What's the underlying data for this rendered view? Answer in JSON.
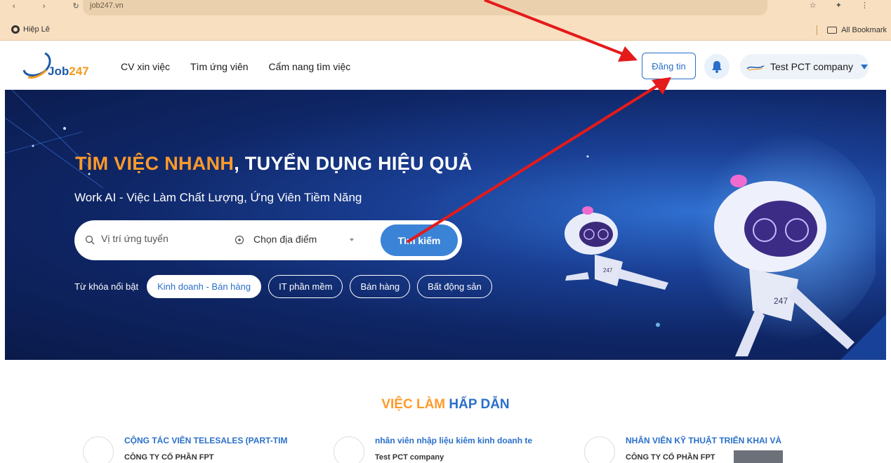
{
  "browser": {
    "url": "job247.vn",
    "bookmark_item": "Hiệp Lê",
    "bookmark_right": "All Bookmark"
  },
  "nav": {
    "logo_word": "Job",
    "logo_num": "247",
    "links": [
      "CV xin việc",
      "Tìm ứng viên",
      "Cẩm nang tìm việc"
    ],
    "post_button": "Đăng tin",
    "company_name": "Test PCT company"
  },
  "hero": {
    "title_highlight": "TÌM VIỆC NHANH",
    "title_rest": ", TUYỂN DỤNG HIỆU QUẢ",
    "subtitle": "Work AI - Việc Làm Chất Lượng, Ứng Viên Tiềm Năng",
    "search_placeholder": "Vị trí ứng tuyển",
    "location_placeholder": "Chọn địa điểm",
    "search_button": "Tìm kiếm",
    "keywords_label": "Từ khóa nổi bật",
    "keywords": [
      "Kinh doanh - Bán hàng",
      "IT phần mềm",
      "Bán hàng",
      "Bất động sản"
    ],
    "robot_badge_1": "247",
    "robot_badge_2": "247"
  },
  "section": {
    "title_orange": "VIỆC LÀM",
    "title_blue": "HẤP DẪN"
  },
  "jobs": [
    {
      "title": "CỘNG TÁC VIÊN TELESALES (PART-TIM",
      "company": "CÔNG TY CỔ PHẦN FPT"
    },
    {
      "title": "nhân viên nhập liệu kiêm kinh doanh te",
      "company": "Test PCT company"
    },
    {
      "title": "NHÂN VIÊN KỸ THUẬT TRIỂN KHAI VÀ",
      "company": "CÔNG TY CỔ PHẦN FPT"
    }
  ],
  "colors": {
    "brand_blue": "#2a6fc9",
    "brand_orange": "#ff9a2b",
    "annotation_red": "#e51a1a"
  }
}
